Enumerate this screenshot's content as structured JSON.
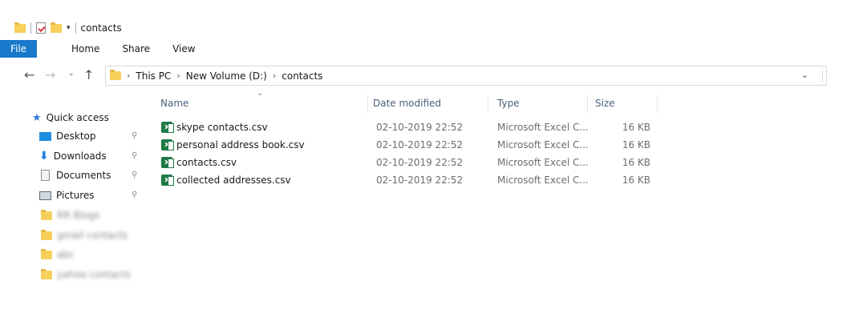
{
  "window": {
    "title": "contacts",
    "quick_access_toolbar": [
      "folder-icon",
      "properties-icon",
      "new-folder-icon",
      "customize-dropdown-icon"
    ]
  },
  "ribbon": {
    "tabs": [
      {
        "label": "File",
        "active": true
      },
      {
        "label": "Home"
      },
      {
        "label": "Share"
      },
      {
        "label": "View"
      }
    ]
  },
  "address_bar": {
    "breadcrumbs": [
      "This PC",
      "New Volume (D:)",
      "contacts"
    ]
  },
  "nav_pane": {
    "quick_access_label": "Quick access",
    "items": [
      {
        "label": "Desktop",
        "icon": "desktop-icon",
        "pinned": true
      },
      {
        "label": "Downloads",
        "icon": "downloads-icon",
        "pinned": true
      },
      {
        "label": "Documents",
        "icon": "documents-icon",
        "pinned": true
      },
      {
        "label": "Pictures",
        "icon": "pictures-icon",
        "pinned": true
      }
    ],
    "blurred_folders": [
      "RR Blogs",
      "gmail contacts",
      "abc",
      "yahoo contacts"
    ]
  },
  "file_list": {
    "columns": [
      "Name",
      "Date modified",
      "Type",
      "Size"
    ],
    "rows": [
      {
        "name": "skype contacts.csv",
        "date": "02-10-2019 22:52",
        "type": "Microsoft Excel C...",
        "size": "16 KB"
      },
      {
        "name": "personal address book.csv",
        "date": "02-10-2019 22:52",
        "type": "Microsoft Excel C...",
        "size": "16 KB"
      },
      {
        "name": "contacts.csv",
        "date": "02-10-2019 22:52",
        "type": "Microsoft Excel C...",
        "size": "16 KB"
      },
      {
        "name": "collected addresses.csv",
        "date": "02-10-2019 22:52",
        "type": "Microsoft Excel C...",
        "size": "16 KB"
      }
    ]
  },
  "colors": {
    "file_tab": "#1979ca",
    "header_text": "#4c607a",
    "excel_green": "#1f7a45",
    "folder_yellow": "#f7cf5b"
  }
}
